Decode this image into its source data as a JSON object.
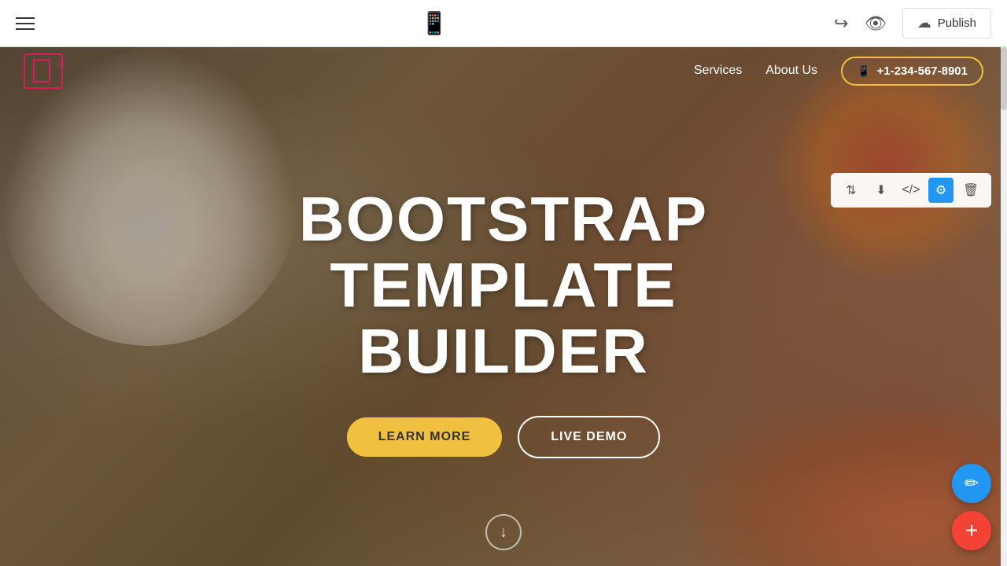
{
  "toolbar": {
    "publish_label": "Publish",
    "hamburger_label": "Menu"
  },
  "nav": {
    "services_label": "Services",
    "about_label": "About Us",
    "phone_number": "+1-234-567-8901"
  },
  "hero": {
    "title_line1": "BOOTSTRAP",
    "title_line2": "TEMPLATE BUILDER",
    "btn_learn_more": "LEARN MORE",
    "btn_live_demo": "LIVE DEMO"
  },
  "section_toolbar": {
    "sort_icon": "⇅",
    "download_icon": "⬇",
    "code_icon": "</>",
    "settings_icon": "⚙",
    "delete_icon": "🗑"
  },
  "fab": {
    "pencil_icon": "✏",
    "plus_icon": "+"
  }
}
